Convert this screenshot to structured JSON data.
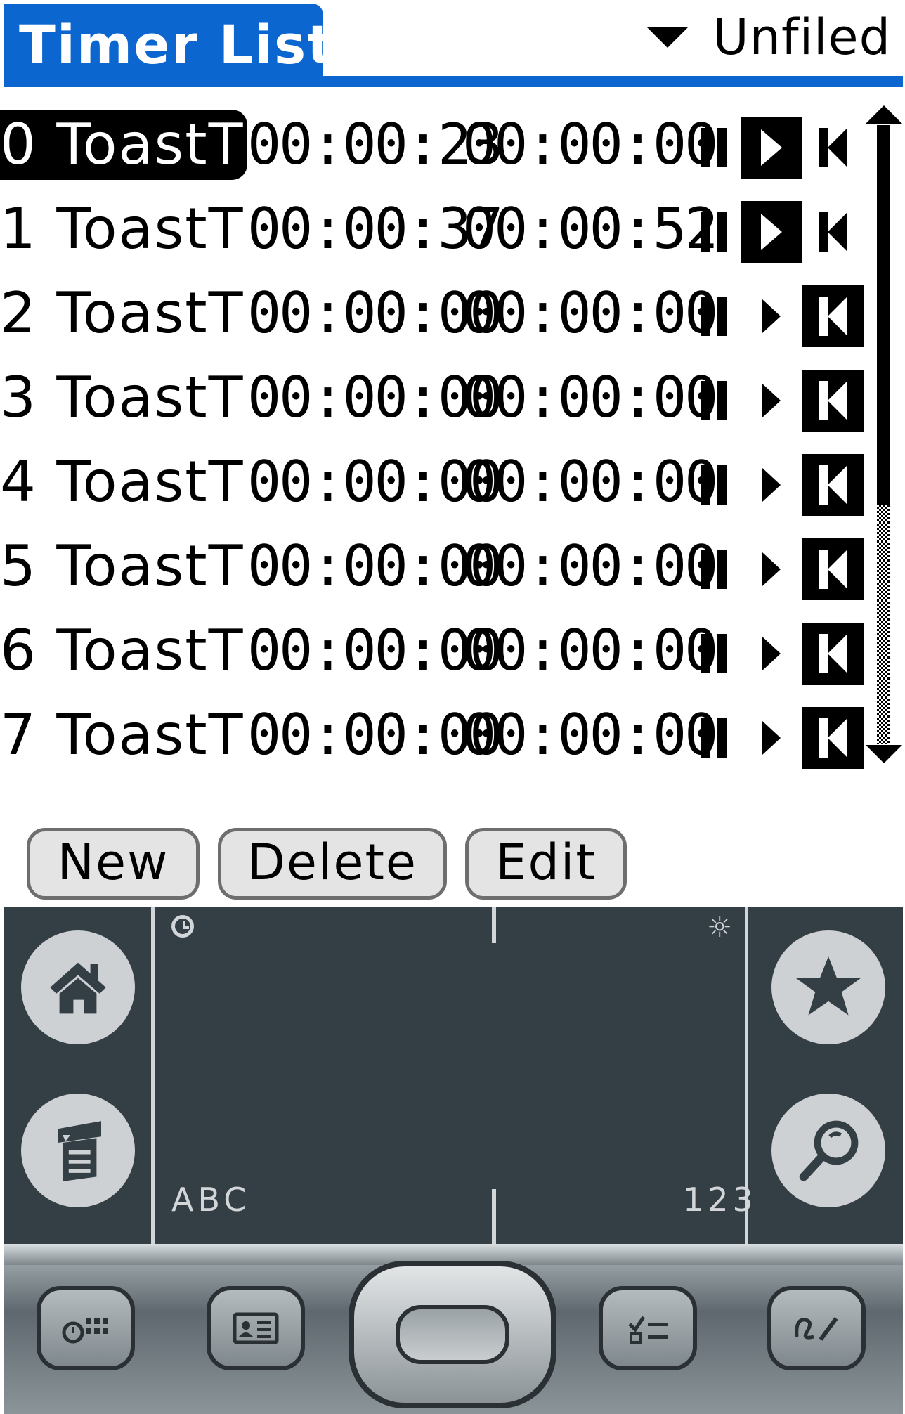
{
  "title": "Timer List",
  "category": "Unfiled",
  "timers": [
    {
      "name": "0 ToastTi",
      "time1": "00:00:23",
      "time2": "00:00:00",
      "selected": true,
      "running": true
    },
    {
      "name": "1 ToastTi",
      "time1": "00:00:37",
      "time2": "00:00:52",
      "selected": false,
      "running": true
    },
    {
      "name": "2 ToastTi",
      "time1": "00:00:00",
      "time2": "00:00:00",
      "selected": false,
      "running": false
    },
    {
      "name": "3 ToastTi",
      "time1": "00:00:00",
      "time2": "00:00:00",
      "selected": false,
      "running": false
    },
    {
      "name": "4 ToastTi",
      "time1": "00:00:00",
      "time2": "00:00:00",
      "selected": false,
      "running": false
    },
    {
      "name": "5 ToastTi",
      "time1": "00:00:00",
      "time2": "00:00:00",
      "selected": false,
      "running": false
    },
    {
      "name": "6 ToastTi",
      "time1": "00:00:00",
      "time2": "00:00:00",
      "selected": false,
      "running": false
    },
    {
      "name": "7 ToastTi",
      "time1": "00:00:00",
      "time2": "00:00:00",
      "selected": false,
      "running": false
    }
  ],
  "buttons": {
    "new": "New",
    "delete": "Delete",
    "edit": "Edit"
  },
  "graffiti": {
    "left_label": "ABC",
    "right_label": "123"
  },
  "colors": {
    "title_bar": "#0b66cf",
    "device_panel": "#343e45",
    "button_fill": "#e4e4e4"
  },
  "icons": {
    "home": "home-icon",
    "menu": "menu-icon",
    "favorite": "star-icon",
    "find": "search-icon",
    "clock": "clock-icon",
    "brightness": "brightness-icon",
    "hw1": "calendar-icon",
    "hw2": "contacts-icon",
    "hw3": "tasks-icon",
    "hw4": "notepad-icon"
  }
}
